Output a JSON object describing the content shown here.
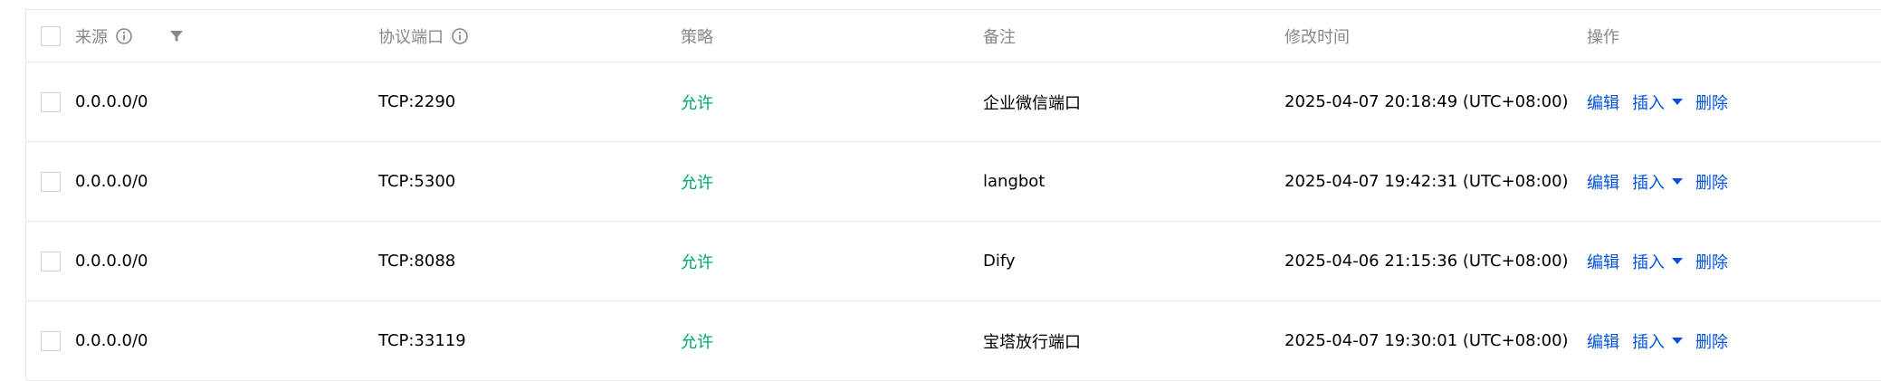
{
  "header": {
    "source": "来源",
    "protocol_port": "协议端口",
    "policy": "策略",
    "note": "备注",
    "modified_time": "修改时间",
    "actions": "操作"
  },
  "rows": [
    {
      "source": "0.0.0.0/0",
      "protocol_port": "TCP:2290",
      "policy": "允许",
      "note": "企业微信端口",
      "modified_time": "2025-04-07 20:18:49 (UTC+08:00)",
      "actions": {
        "edit": "编辑",
        "insert": "插入",
        "delete": "删除"
      }
    },
    {
      "source": "0.0.0.0/0",
      "protocol_port": "TCP:5300",
      "policy": "允许",
      "note": "langbot",
      "modified_time": "2025-04-07 19:42:31 (UTC+08:00)",
      "actions": {
        "edit": "编辑",
        "insert": "插入",
        "delete": "删除"
      }
    },
    {
      "source": "0.0.0.0/0",
      "protocol_port": "TCP:8088",
      "policy": "允许",
      "note": "Dify",
      "modified_time": "2025-04-06 21:15:36 (UTC+08:00)",
      "actions": {
        "edit": "编辑",
        "insert": "插入",
        "delete": "删除"
      }
    },
    {
      "source": "0.0.0.0/0",
      "protocol_port": "TCP:33119",
      "policy": "允许",
      "note": "宝塔放行端口",
      "modified_time": "2025-04-07 19:30:01 (UTC+08:00)",
      "actions": {
        "edit": "编辑",
        "insert": "插入",
        "delete": "删除"
      }
    }
  ],
  "colors": {
    "header_text": "#888888",
    "allow": "#00a870",
    "link": "#0052d9",
    "border": "#e7e7e7"
  },
  "icons": {
    "source_info": "info-circle-icon",
    "filter": "filter-icon",
    "protocol_info": "info-circle-icon",
    "insert_dropdown": "caret-down-icon"
  }
}
